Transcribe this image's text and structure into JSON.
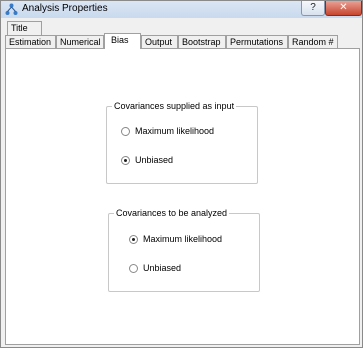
{
  "window": {
    "title": "Analysis Properties",
    "help_label": "?",
    "close_label": "✕"
  },
  "tabs": {
    "row_back": [
      {
        "label": "Title"
      }
    ],
    "row_front": [
      {
        "label": "Estimation"
      },
      {
        "label": "Numerical"
      },
      {
        "label": "Bias"
      },
      {
        "label": "Output"
      },
      {
        "label": "Bootstrap"
      },
      {
        "label": "Permutations"
      },
      {
        "label": "Random #"
      }
    ],
    "active": "Bias"
  },
  "groups": {
    "supplied": {
      "title": "Covariances supplied as input",
      "options": [
        {
          "label": "Maximum likelihood",
          "checked": false
        },
        {
          "label": "Unbiased",
          "checked": true
        }
      ]
    },
    "analyzed": {
      "title": "Covariances to be analyzed",
      "options": [
        {
          "label": "Maximum likelihood",
          "checked": true
        },
        {
          "label": "Unbiased",
          "checked": false
        }
      ]
    }
  }
}
